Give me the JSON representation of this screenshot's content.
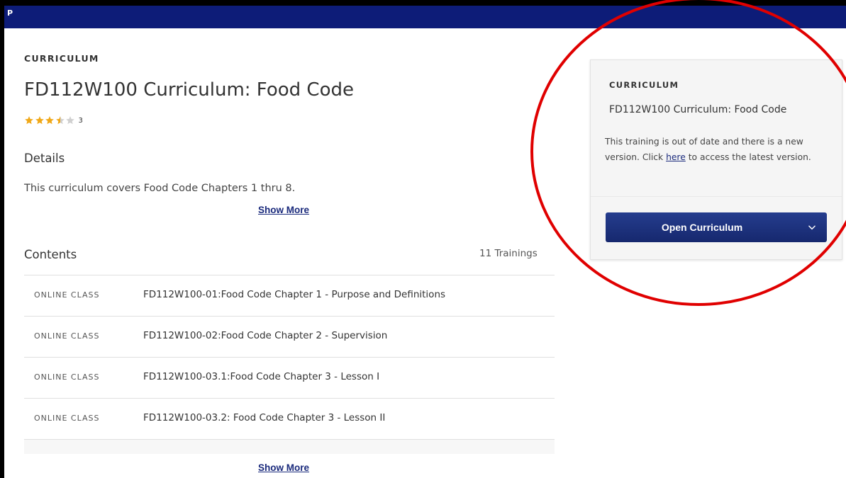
{
  "topbar": {
    "letter": "P",
    "color": "#0d1c78"
  },
  "curriculum": {
    "eyebrow": "CURRICULUM",
    "title": "FD112W100 Curriculum: Food Code",
    "rating": {
      "value": 3.5,
      "max": 5,
      "count": "3"
    },
    "details_heading": "Details",
    "description": "This curriculum covers Food Code Chapters 1 thru 8.",
    "show_more_details": "Show More",
    "contents_heading": "Contents",
    "trainings_count": "11 Trainings",
    "items": [
      {
        "type": "ONLINE CLASS",
        "title": "FD112W100-01:Food Code Chapter 1 - Purpose and Definitions"
      },
      {
        "type": "ONLINE CLASS",
        "title": "FD112W100-02:Food Code Chapter 2 - Supervision"
      },
      {
        "type": "ONLINE CLASS",
        "title": "FD112W100-03.1:Food Code Chapter 3 - Lesson I"
      },
      {
        "type": "ONLINE CLASS",
        "title": "FD112W100-03.2: Food Code Chapter 3 - Lesson II"
      }
    ],
    "show_more_contents": "Show More"
  },
  "sidebar_card": {
    "eyebrow": "CURRICULUM",
    "title": "FD112W100 Curriculum: Food Code",
    "message_before": "This training is out of date and there is a new version. Click ",
    "link_text": "here",
    "message_after": " to access the latest version.",
    "button_label": "Open Curriculum",
    "button_color": "#1a2e7e"
  },
  "colors": {
    "star": "#f0a818",
    "star_empty": "#d0d0d0",
    "link": "#1a2a7c",
    "annotation_circle": "#e00000"
  },
  "icons": {
    "rating": "star-icon",
    "dropdown": "chevron-down-icon"
  }
}
